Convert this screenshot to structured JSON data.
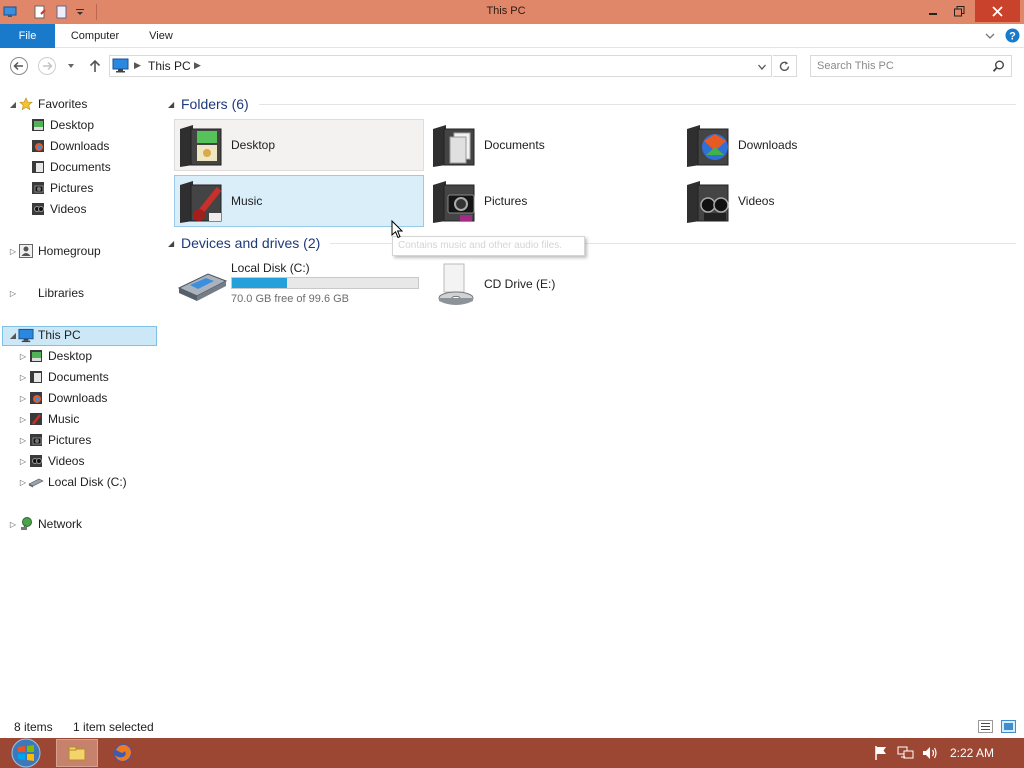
{
  "window": {
    "title": "This PC"
  },
  "ribbon": {
    "tabs": [
      "File",
      "Computer",
      "View"
    ]
  },
  "address": {
    "crumb": "This PC",
    "search_placeholder": "Search This PC"
  },
  "nav": {
    "favorites": {
      "label": "Favorites",
      "items": [
        "Desktop",
        "Downloads",
        "Documents",
        "Pictures",
        "Videos"
      ]
    },
    "homegroup": "Homegroup",
    "libraries": "Libraries",
    "thispc": {
      "label": "This PC",
      "items": [
        "Desktop",
        "Documents",
        "Downloads",
        "Music",
        "Pictures",
        "Videos",
        "Local Disk (C:)"
      ]
    },
    "network": "Network"
  },
  "content": {
    "folders_header": "Folders (6)",
    "folders": [
      "Desktop",
      "Documents",
      "Downloads",
      "Music",
      "Pictures",
      "Videos"
    ],
    "devices_header": "Devices and drives (2)",
    "drives": [
      {
        "name": "Local Disk (C:)",
        "free_text": "70.0 GB free of 99.6 GB",
        "used_fraction": 0.297
      },
      {
        "name": "CD Drive (E:)"
      }
    ],
    "tooltip": "Contains music and other audio files."
  },
  "status": {
    "items": "8 items",
    "selected": "1 item selected"
  },
  "taskbar": {
    "time": "2:22 AM"
  },
  "colors": {
    "titlebar": "#e0876a",
    "taskbar": "#9c4733",
    "selection": "#cce8f7",
    "accent": "#1979ca"
  }
}
